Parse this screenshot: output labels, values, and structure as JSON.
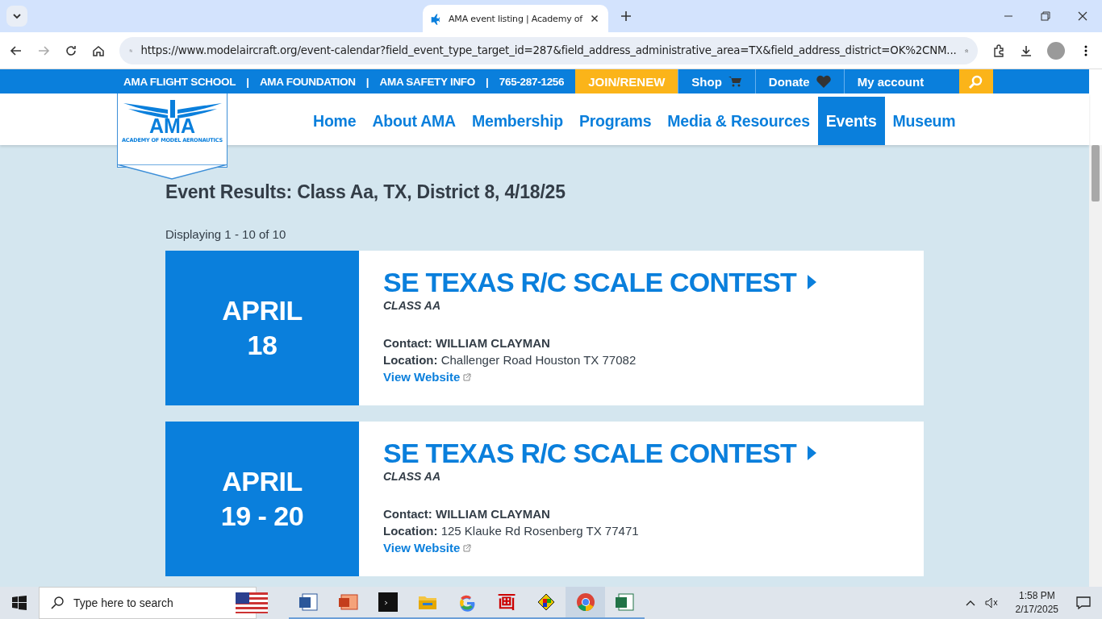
{
  "browser": {
    "tab_title": "AMA event listing | Academy of",
    "url": "https://www.modelaircraft.org/event-calendar?field_event_type_target_id=287&field_address_administrative_area=TX&field_address_district=OK%2CNM..."
  },
  "site": {
    "top_links": [
      {
        "kind": "link",
        "text": "AMA FLIGHT SCHOOL"
      },
      {
        "kind": "separator",
        "text": "|"
      },
      {
        "kind": "link",
        "text": "AMA FOUNDATION"
      },
      {
        "kind": "separator",
        "text": "|"
      },
      {
        "kind": "link",
        "text": "AMA SAFETY INFO"
      },
      {
        "kind": "separator",
        "text": "|"
      },
      {
        "kind": "link",
        "text": "765-287-1256"
      }
    ],
    "join": "JOIN/RENEW",
    "shop": "Shop",
    "donate": "Donate",
    "account": "My account",
    "logo": {
      "text": "AMA",
      "subtitle": "ACADEMY OF MODEL AERONAUTICS"
    },
    "nav": [
      {
        "label": "Home",
        "selected": false
      },
      {
        "label": "About AMA",
        "selected": false
      },
      {
        "label": "Membership",
        "selected": false
      },
      {
        "label": "Programs",
        "selected": false
      },
      {
        "label": "Media & Resources",
        "selected": false
      },
      {
        "label": "Events",
        "selected": true
      },
      {
        "label": "Museum",
        "selected": false
      }
    ]
  },
  "heading": "Event Results: Class Aa, TX, District 8, 4/18/25",
  "summary": "Displaying 1 - 10 of 10",
  "events": [
    {
      "month": "APRIL",
      "days": "18",
      "title": "SE TEXAS R/C SCALE CONTEST",
      "class": "CLASS AA",
      "contact_label": "Contact:",
      "contact": "WILLIAM CLAYMAN",
      "location_label": "Location:",
      "location": "Challenger Road Houston TX 77082",
      "link": "View Website"
    },
    {
      "month": "APRIL",
      "days": "19 - 20",
      "title": "SE TEXAS R/C SCALE CONTEST",
      "class": "CLASS AA",
      "contact_label": "Contact:",
      "contact": "WILLIAM CLAYMAN",
      "location_label": "Location:",
      "location": "125 Klauke Rd Rosenberg TX 77471",
      "link": "View Website"
    }
  ],
  "taskbar": {
    "search_placeholder": "Type here to search",
    "apps": [
      {
        "kind": "flag",
        "active": false
      },
      {
        "kind": "word",
        "active": false
      },
      {
        "kind": "slides",
        "active": false
      },
      {
        "kind": "terminal",
        "active": false
      },
      {
        "kind": "folder",
        "active": false
      },
      {
        "kind": "google",
        "active": false
      },
      {
        "kind": "glyph",
        "text": "画",
        "active": false
      },
      {
        "kind": "paint",
        "active": false
      },
      {
        "kind": "chrome",
        "active": true
      },
      {
        "kind": "excel",
        "active": false
      }
    ],
    "time": "1:58 PM",
    "date": "2/17/2025"
  }
}
